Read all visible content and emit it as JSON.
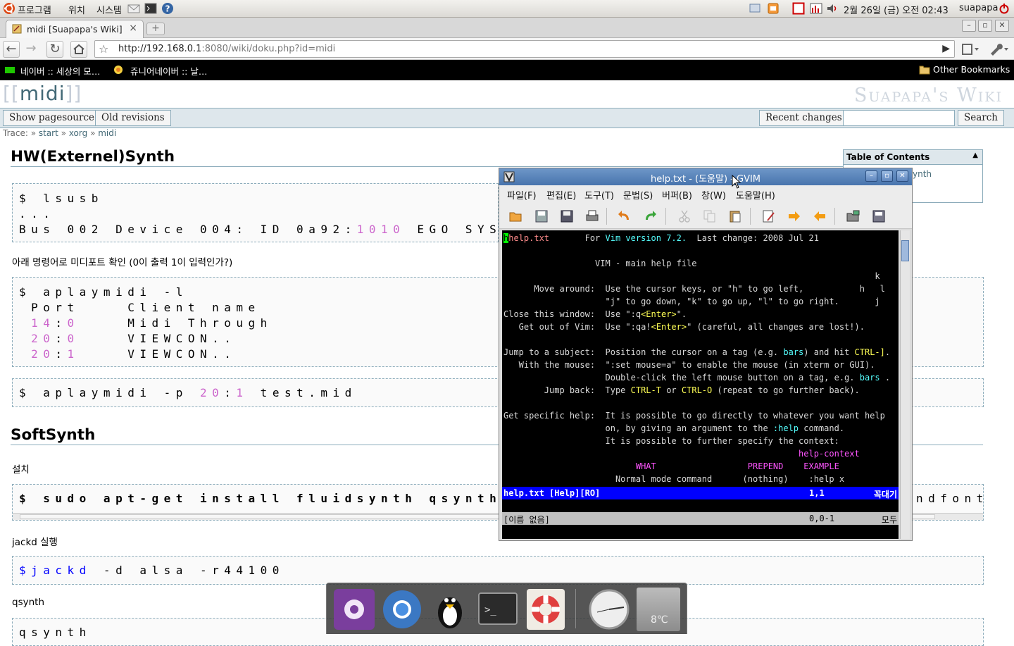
{
  "panel": {
    "menus": [
      "프로그램",
      "위치",
      "시스템"
    ],
    "clock": "2월 26일 (금) 오전 02:43",
    "user": "suapapa"
  },
  "browser": {
    "tab_title": "midi [Suapapa's Wiki]",
    "new_tab": "+",
    "tab_close": "×",
    "url_host": "http://192.168.0.1",
    "url_rest": ":8080/wiki/doku.php?id=midi",
    "bookmarks": [
      "네이버 :: 세상의 모…",
      "쥬니어네이버 :: 날…"
    ],
    "other_bookmarks": "Other Bookmarks"
  },
  "wiki": {
    "page_title": "midi",
    "site_name": "Suapapa's Wiki",
    "buttons": {
      "show_source": "Show pagesource",
      "old_revisions": "Old revisions",
      "recent_changes": "Recent changes",
      "search": "Search"
    },
    "trace_label": "Trace:",
    "trace": [
      "start",
      "xorg",
      "midi"
    ],
    "toc_title": "Table of Contents",
    "toc_peek": "ynth",
    "h_hw": "HW(Externel)Synth",
    "code1": {
      "l1": "$ lsusb",
      "l2": "...",
      "l3a": "Bus 002 Device 004: ID 0a92:",
      "l3num": "1010",
      "l3b": " EGO SYS"
    },
    "p_check": "아래 명령어로 미디포트 확인 (0이 출력 1이 입력인가?)",
    "code2": {
      "cmd": "$ aplaymidi -l",
      "header": " Port    Client name",
      "rows": [
        {
          "a": "14",
          "b": "0",
          "name": "Midi Through"
        },
        {
          "a": "20",
          "b": "0",
          "name": "VIEWCON.."
        },
        {
          "a": "20",
          "b": "1",
          "name": "VIEWCON.."
        }
      ]
    },
    "code3": {
      "pre": "$ aplaymidi -p ",
      "a": "20",
      "b": "1",
      "post": " test.mid"
    },
    "h_soft": "SoftSynth",
    "p_install": "설치",
    "code4": "$ sudo apt-get install fluidsynth qsynth",
    "code4_tail": "ndfont",
    "p_jackd": "jackd 실행",
    "code5": {
      "cmd": "$jackd",
      "rest": " -d alsa -r44100"
    },
    "p_qsynth": "qsynth",
    "code6": "qsynth"
  },
  "gvim": {
    "title": "help.txt - (도움말) - GVIM",
    "menus": [
      "파일(F)",
      "편집(E)",
      "도구(T)",
      "문법(S)",
      "버퍼(B)",
      "창(W)",
      "도움말(H)"
    ],
    "status1_left": "help.txt [Help][RO]",
    "status1_pos": "1,1",
    "status1_right": "꼭대기",
    "status2_left": "[이름 없음]",
    "status2_pos": "0,0-1",
    "status2_right": "모두",
    "text": {
      "l1_tag": "help.txt",
      "l1_for": "For ",
      "l1_vim": "Vim version 7.2.",
      "l1_rest": "  Last change: 2008 Jul 21",
      "l2": "                  VIM - main help file",
      "l3": "                                                                         k",
      "l4a": "      Move around:  Use the cursor keys, or \"h\" to go left,",
      "l4b": "           h   l",
      "l5a": "                    \"j\" to go down, \"k\" to go up, \"l\" to go right.",
      "l5b": "       j",
      "l6a": "Close this window:  Use \":q",
      "l6key": "<Enter>",
      "l6b": "\".",
      "l7a": "   Get out of Vim:  Use \":qa!",
      "l7key": "<Enter>",
      "l7b": "\" (careful, all changes are lost!).",
      "l8a": "Jump to a subject:  Position the cursor on a tag (e.g. ",
      "l8tag": "bars",
      "l8b": ") and hit ",
      "l8key": "CTRL-]",
      "l8c": ".",
      "l9": "   With the mouse:  \":set mouse=a\" to enable the mouse (in xterm or GUI).",
      "l10a": "                    Double-click the left mouse button on a tag, e.g. ",
      "l10tag": "bars",
      "l10b": " .",
      "l11a": "        Jump back:  Type ",
      "l11k1": "CTRL-T",
      "l11b": " or ",
      "l11k2": "CTRL-O",
      "l11c": " (repeat to go further back).",
      "l12": "Get specific help:  It is possible to go directly to whatever you want help",
      "l13a": "                    on, by giving an argument to the ",
      "l13tag": ":help",
      "l13b": " command.",
      "l14": "                    It is possible to further specify the context:",
      "l15": "                                                          help-context",
      "l16a": "                          WHAT",
      "l16b": "                  PREPEND",
      "l16c": "    EXAMPLE",
      "l17": "                      Normal mode command      (nothing)    :help x"
    }
  },
  "dock": {
    "temp": "8℃"
  }
}
